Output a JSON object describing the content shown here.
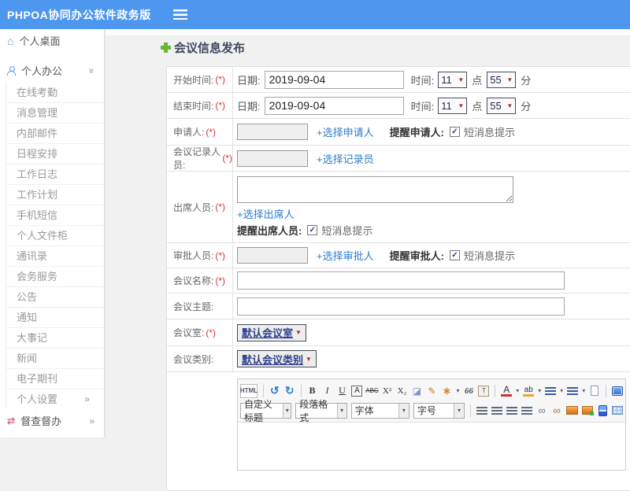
{
  "colors": {
    "topbar": "#4d97ee",
    "link": "#2e7bcc",
    "required": "#e03131",
    "plus": "#67b637"
  },
  "icons": {
    "home": "⌂",
    "supervise": "⇄",
    "chevron": "»",
    "select_arrow": "▼",
    "dropdown_arrow": "▾",
    "check": "✓"
  },
  "topbar": {
    "title": "PHPOA协同办公软件政务版"
  },
  "sidebar": {
    "items": [
      {
        "label": "个人桌面"
      },
      {
        "label": "个人办公"
      },
      {
        "label": "在线考勤"
      },
      {
        "label": "消息管理"
      },
      {
        "label": "内部邮件"
      },
      {
        "label": "日程安排"
      },
      {
        "label": "工作日志"
      },
      {
        "label": "工作计划"
      },
      {
        "label": "手机短信"
      },
      {
        "label": "个人文件柜"
      },
      {
        "label": "通讯录"
      },
      {
        "label": "会务服务"
      },
      {
        "label": "公告"
      },
      {
        "label": "通知"
      },
      {
        "label": "大事记"
      },
      {
        "label": "新闻"
      },
      {
        "label": "电子期刊"
      },
      {
        "label": "个人设置"
      },
      {
        "label": "督查督办"
      }
    ]
  },
  "main": {
    "heading": "会议信息发布"
  },
  "form": {
    "start_time": {
      "label": "开始时间:",
      "req": "(*)",
      "date_label": "日期:",
      "date": "2019-09-04",
      "time_label": "时间:",
      "hour": "11",
      "hour_unit": "点",
      "minute": "55",
      "minute_unit": "分"
    },
    "end_time": {
      "label": "结束时间:",
      "req": "(*)",
      "date_label": "日期:",
      "date": "2019-09-04",
      "time_label": "时间:",
      "hour": "11",
      "hour_unit": "点",
      "minute": "55",
      "minute_unit": "分"
    },
    "applicant": {
      "label": "申请人:",
      "req": "(*)",
      "choose": "+选择申请人",
      "remind": "提醒申请人:",
      "sms": "短消息提示"
    },
    "recorder": {
      "label": "会议记录人员:",
      "req": "(*)",
      "choose": "+选择记录员"
    },
    "attendees": {
      "label": "出席人员:",
      "req": "(*)",
      "choose": "+选择出席人",
      "remind": "提醒出席人员:",
      "sms": "短消息提示"
    },
    "approver": {
      "label": "审批人员:",
      "req": "(*)",
      "choose": "+选择审批人",
      "remind": "提醒审批人:",
      "sms": "短消息提示"
    },
    "name": {
      "label": "会议名称:",
      "req": "(*)"
    },
    "topic": {
      "label": "会议主题:"
    },
    "room": {
      "label": "会议室:",
      "req": "(*)",
      "value": "默认会议室"
    },
    "category": {
      "label": "会议类别:",
      "value": "默认会议类别"
    }
  },
  "editor": {
    "buttons": {
      "html": "HTML",
      "undo": "↺",
      "redo": "↻",
      "bold": "B",
      "italic": "I",
      "underline": "U",
      "font_border": "A",
      "strike": "ABC",
      "superscript": "X²",
      "subscript": "X₂",
      "eraser": "◪",
      "brush": "✎",
      "autoformat": "∗",
      "quote": "66",
      "paste": "T",
      "forecolor": "A",
      "hilite": "ab",
      "link": "∞",
      "unlink": "∞"
    },
    "combos": {
      "heading": "自定义标题",
      "paragraph": "段落格式",
      "font": "字体",
      "size": "字号"
    }
  }
}
